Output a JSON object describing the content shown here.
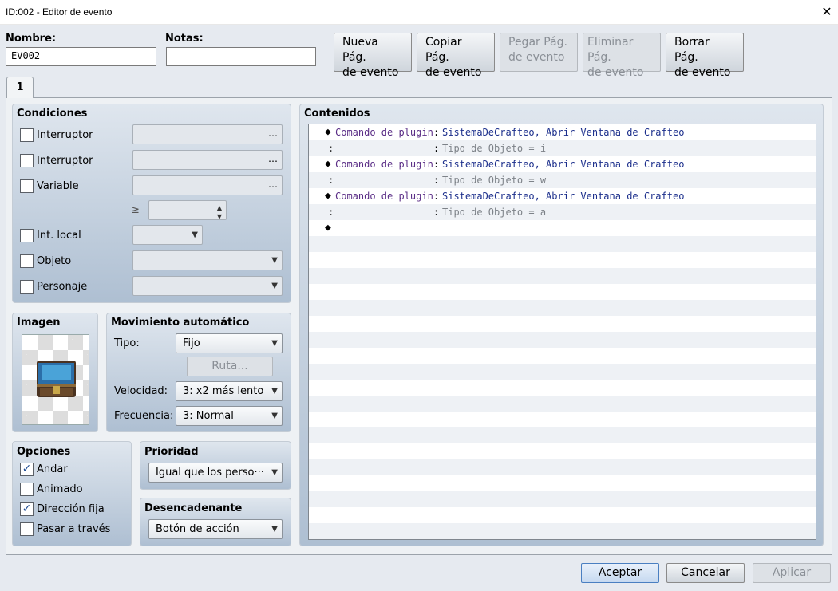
{
  "window": {
    "title": "ID:002 - Editor de evento",
    "close_icon": "close-icon"
  },
  "header": {
    "name_label": "Nombre:",
    "name_value": "EV002",
    "notes_label": "Notas:",
    "notes_value": "",
    "buttons": [
      {
        "l1": "Nueva Pág.",
        "l2": "de evento",
        "enabled": true
      },
      {
        "l1": "Copiar Pág.",
        "l2": "de evento",
        "enabled": true
      },
      {
        "l1": "Pegar Pág.",
        "l2": "de evento",
        "enabled": false
      },
      {
        "l1": "Eliminar Pág.",
        "l2": "de evento",
        "enabled": false
      },
      {
        "l1": "Borrar Pág.",
        "l2": "de evento",
        "enabled": true
      }
    ]
  },
  "tabs": [
    "1"
  ],
  "conditions": {
    "title": "Condiciones",
    "switch1_label": "Interruptor",
    "switch2_label": "Interruptor",
    "variable_label": "Variable",
    "gte_symbol": "≥",
    "self_switch_label": "Int. local",
    "item_label": "Objeto",
    "actor_label": "Personaje",
    "ellipsis": "…"
  },
  "image": {
    "title": "Imagen",
    "sprite": "treasure-chest-icon"
  },
  "autonomous": {
    "title": "Movimiento automático",
    "type_label": "Tipo:",
    "type_value": "Fijo",
    "route_button": "Ruta...",
    "speed_label": "Velocidad:",
    "speed_value": "3: x2 más lento",
    "freq_label": "Frecuencia:",
    "freq_value": "3: Normal"
  },
  "options": {
    "title": "Opciones",
    "items": [
      {
        "label": "Andar",
        "checked": true
      },
      {
        "label": "Animado",
        "checked": false
      },
      {
        "label": "Dirección fija",
        "checked": true
      },
      {
        "label": "Pasar a través",
        "checked": false
      }
    ]
  },
  "priority": {
    "title": "Prioridad",
    "value": "Igual que los perso···"
  },
  "trigger": {
    "title": "Desencadenante",
    "value": "Botón de acción"
  },
  "contents": {
    "title": "Contenidos",
    "rows": [
      {
        "kind": "cmd",
        "cmd": "Comando de plugin",
        "colon": ":",
        "text": "SistemaDeCrafteo, Abrir Ventana de Crafteo"
      },
      {
        "kind": "sub",
        "cmd": ":",
        "colon": ":",
        "text": "Tipo de Objeto = i"
      },
      {
        "kind": "cmd",
        "cmd": "Comando de plugin",
        "colon": ":",
        "text": "SistemaDeCrafteo, Abrir Ventana de Crafteo"
      },
      {
        "kind": "sub",
        "cmd": ":",
        "colon": ":",
        "text": "Tipo de Objeto = w"
      },
      {
        "kind": "cmd",
        "cmd": "Comando de plugin",
        "colon": ":",
        "text": "SistemaDeCrafteo, Abrir Ventana de Crafteo"
      },
      {
        "kind": "sub",
        "cmd": ":",
        "colon": ":",
        "text": "Tipo de Objeto = a"
      },
      {
        "kind": "empty",
        "cmd": "",
        "colon": "",
        "text": ""
      }
    ],
    "diamond": "◆"
  },
  "footer": {
    "ok": "Aceptar",
    "cancel": "Cancelar",
    "apply": "Aplicar"
  }
}
